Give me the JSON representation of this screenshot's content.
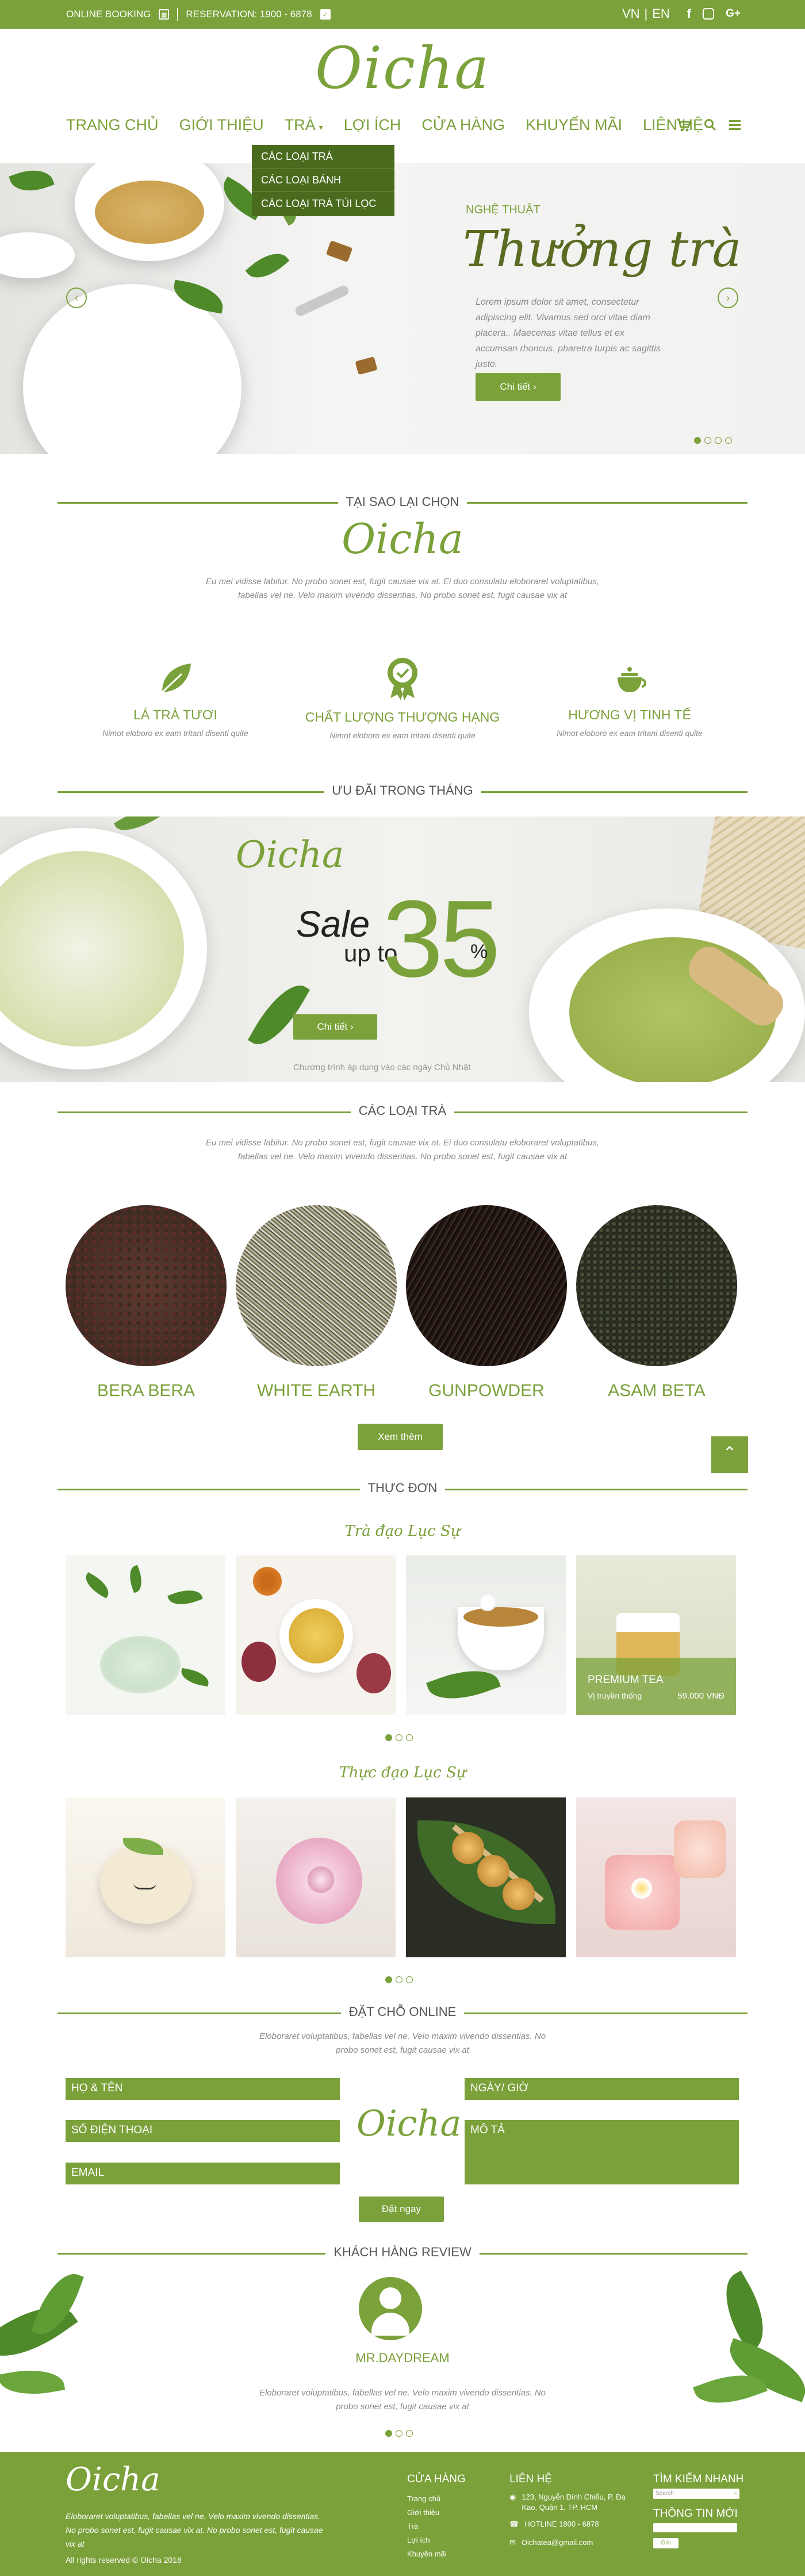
{
  "colors": {
    "brand": "#7ba13a",
    "dark": "#4a6b1e"
  },
  "topbar": {
    "online": "ONLINE BOOKING",
    "reservation": "RESERVATION: 1900 - 6878",
    "lang_vn": "VN",
    "lang_sep": "|",
    "lang_en": "EN"
  },
  "brand": {
    "logo": "Oicha"
  },
  "nav": {
    "items": [
      "TRANG CHỦ",
      "GIỚI THIỆU",
      "TRÀ",
      "LỢI ÍCH",
      "CỬA HÀNG",
      "KHUYẾN MÃI",
      "LIÊN HỆ"
    ]
  },
  "dropdown": {
    "items": [
      "CÁC LOẠI TRÀ",
      "CÁC LOẠI BÁNH",
      "CÁC LOẠI TRÀ TÚI LỌC"
    ]
  },
  "hero": {
    "subtitle": "NGHỆ THUẬT",
    "title": "Thưởng trà",
    "text": "Lorem ipsum dolor sit amet, consectetur adipiscing elit. Vivamus sed orci vitae diam placera.. Maecenas vitae tellus et ex accumsan rhoncus. pharetra turpis ac sagittis justo.",
    "button": "Chi tiết  ›"
  },
  "why": {
    "title": "TẠI SAO LẠI CHỌN",
    "logo": "Oicha",
    "text": "Eu mei vidisse labitur. No probo sonet est, fugit causae vix at. Ei duo consulatu eloboraret voluptatibus, fabellas vel ne. Velo maxim vivendo dissentias. No probo sonet est, fugit causae vix at"
  },
  "features": [
    {
      "title": "LÁ TRÀ TƯƠI",
      "text": "Nimot eloboro ex eam tritani disenti quite"
    },
    {
      "title": "CHẤT LƯỢNG THƯỢNG HẠNG",
      "text": "Nimot eloboro ex eam tritani disenti quite"
    },
    {
      "title": "HƯƠNG VỊ TINH TẾ",
      "text": "Nimot eloboro ex eam tritani disenti quite"
    }
  ],
  "deal": {
    "title": "ƯU ĐÃI TRONG THÁNG",
    "logo": "Oicha",
    "sale": "Sale",
    "upto": "up to",
    "number": "35",
    "percent": "%",
    "button": "Chi tiết  ›",
    "note": "Chương trình áp dụng vào các ngày Chủ Nhật"
  },
  "teas": {
    "title": "CÁC LOẠI TRÀ",
    "text": "Eu mei vidisse labitur. No probo sonet est, fugit causae vix at. Ei duo consulatu eloboraret voluptatibus, fabellas vel ne. Velo maxim vivendo dissentias. No probo sonet est, fugit causae vix at",
    "items": [
      "BERA BERA",
      "WHITE EARTH",
      "GUNPOWDER",
      "ASAM BETA"
    ],
    "more": "Xem thêm"
  },
  "menu": {
    "title": "THỰC ĐƠN",
    "tea_heading": "Trà đạo Lục Sự",
    "food_heading": "Thực đạo Lục Sự",
    "featured": {
      "name": "PREMIUM TEA",
      "desc": "Vị truyền thống",
      "price": "59.000 VNĐ"
    }
  },
  "booking": {
    "title": "ĐẶT CHỖ ONLINE",
    "text": "Eloboraret voluptatibus, fabellas vel ne. Velo maxim vivendo dissentias. No probo sonet est, fugit causae vix at",
    "name": "HỌ & TÊN",
    "phone": "SỐ ĐIỆN THOẠI",
    "email": "EMAIL",
    "datetime": "NGÀY/ GIỜ",
    "desc": "MÔ TẢ",
    "logo": "Oicha",
    "submit": "Đặt ngay"
  },
  "review": {
    "title": "KHÁCH HÀNG REVIEW",
    "name": "MR.DAYDREAM",
    "text": "Eloboraret voluptatibus, fabellas vel ne. Velo maxim vivendo dissentias. No probo sonet est, fugit causae vix at"
  },
  "footer": {
    "logo": "Oicha",
    "text": "Eloboraret voluptatibus, fabellas vel ne. Velo maxim vivendo dissentias. No probo sonet est, fugit causae vix at. No probo sonet est, fugit causae vix at",
    "copyright": "All rights reserved © Oicha 2018",
    "store_title": "CỬA HÀNG",
    "store_items": [
      "Trang chủ",
      "Giới thiệu",
      "Trà",
      "Lợi ích",
      "Khuyến mãi"
    ],
    "contact_title": "LIÊN HỆ",
    "address": "123, Nguyễn Đình Chiểu, P. Đa Kao, Quận 1, TP. HCM",
    "hotline": "HOTLINE 1800 - 6878",
    "email": "Oichatea@gmail.com",
    "search_title": "TÌM KIẾM NHANH",
    "search_placeholder": "Search",
    "newsletter_title": "THÔNG TIN MỚI",
    "subscribe": "Gửi"
  }
}
